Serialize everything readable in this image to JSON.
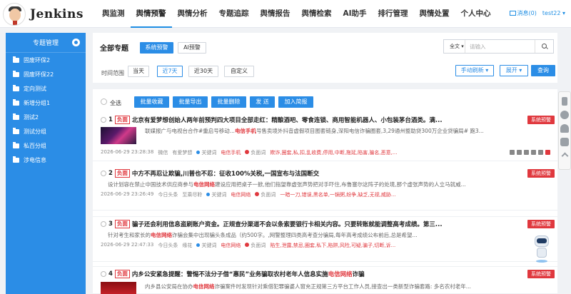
{
  "app": {
    "logo_text": "Jenkins"
  },
  "nav": {
    "items": [
      "舆监测",
      "舆情预警",
      "舆情分析",
      "专题追踪",
      "舆情报告",
      "舆情检索",
      "AI助手",
      "排行管理",
      "舆情处置",
      "个人中心"
    ],
    "active_index": 1
  },
  "user": {
    "messages_label": "消息(0)",
    "username": "test22"
  },
  "sidebar": {
    "title": "专题管理",
    "items": [
      "固废环保2",
      "固废环保22",
      "定向测试",
      "新增分组1",
      "测试2",
      "测试分组",
      "私百分组",
      "涉电信息"
    ]
  },
  "filter": {
    "title": "全部专题",
    "tab_system": "系统预警",
    "tab_ai": "AI预警",
    "time_label": "时间范围",
    "time_options": [
      "当天",
      "近7天",
      "近30天",
      "自定义"
    ],
    "time_active": "近7天",
    "search_scope": "全文",
    "search_placeholder": "请输入",
    "refresh_label": "手动刷新",
    "expand_label": "展开",
    "query_label": "查询"
  },
  "toolbar": {
    "select_all": "全选",
    "buttons": [
      "批量收藏",
      "批量导出",
      "批量删除",
      "发 送",
      "加入简报"
    ]
  },
  "items": [
    {
      "index": "1",
      "tag": "负面",
      "title": "北京有爱梦想创始人两年前预判四大项目全部走红：精酿酒吧、零食连锁、商用智能机器人、小包装茅台酒类。满...",
      "body_pre": "联媒报广与电视台合作#重启号移动...",
      "body_hl": "电信手机",
      "body_post": "号售卖境外抖音虚假项目图套链身,深阳电信诈骗圈套,3,29通州整助贷300万企业贷骗局# 跑3...",
      "date": "2026-06-29 23:28:38",
      "source": "微信",
      "author": "有爱梦想",
      "kw_label": "关键词",
      "kw": "电信手机",
      "sent_label": "负面词",
      "neg_words": "欺诈,圈套,私,扣,乱收费,停用,中断,拖延,陷害,骗名,恶意,...",
      "warn": "系统预警"
    },
    {
      "index": "2",
      "tag": "负面",
      "title": "中方不再忍让欺骗,川普也不忍：征收100%关税,一国宣布与法国断交",
      "body_pre": "设计划容在禁止中国技术供应商参与",
      "body_hl": "电信网络",
      "body_post": "建设应用把桌子一掀,他们指望靠虚张声势把对手吓住,布鲁塞尔这阵子的处境,那个虚张声势的人立马就威...",
      "date": "2026-06-29 23:26:49",
      "source": "今日头条",
      "author": "至乘尽聆",
      "kw_label": "关键词",
      "kw": "电信网络",
      "sent_label": "负面词",
      "neg_words": "一暗一刀,错误,黑名单,一锅粥,纷争,缺乏,无视,威胁...",
      "warn": "系统预警"
    },
    {
      "index": "3",
      "tag": "负面",
      "title": "骗子还会利用信息盗刷账户资金。正规查分渠道不会以条索要银行卡相关内容。只要转账就能调整高考成绩。第三...",
      "body_pre": "针对考生和家长的",
      "body_hl": "电信网络",
      "body_post": "诈骗会集中出现骗头条成品（约500字。,网警整理四类高考查分骗局,每年高考成绩公布前后,总是希望...",
      "date": "2026-06-29 22:47:33",
      "source": "今日头条",
      "author": "缘花",
      "kw_label": "关键词",
      "kw": "电信网络",
      "sent_label": "负面词",
      "neg_words": "陷生,泄露,禁忌,圈套,私下,陷阱,风险,可疑,骗子,切断,诉...",
      "warn": "系统预警"
    },
    {
      "index": "4",
      "tag": "负面",
      "title_pre": "内乡公安紧急提醒：警惕不法分子借“惠民”业务骗取农村老年人信息实施",
      "title_hl": "电信网络",
      "title_post": "诈骗",
      "body_pre": "内乡县公安局在协办",
      "body_hl": "电信网络",
      "body_post": "诈骗案件时发现针对乘借犯罪骗婆人窗充正规第三方平台工作人员,接查出一类新型诈骗套路: 多名农村老年...",
      "warn": "系统预警"
    }
  ],
  "colors": {
    "accent": "#2b8de6",
    "negative": "#e0383e"
  }
}
